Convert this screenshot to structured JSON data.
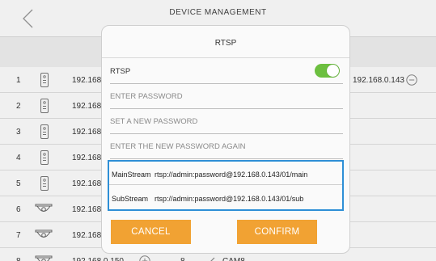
{
  "header": {
    "title": "DEVICE MANAGEMENT"
  },
  "rows": [
    {
      "index": "1",
      "kind": "device",
      "ip": "192.168.",
      "ip_right": "192.168.0.143",
      "has_remove": true
    },
    {
      "index": "2",
      "kind": "device",
      "ip": "192.168."
    },
    {
      "index": "3",
      "kind": "device",
      "ip": "192.168."
    },
    {
      "index": "4",
      "kind": "device",
      "ip": "192.168."
    },
    {
      "index": "5",
      "kind": "device",
      "ip": "192.168."
    },
    {
      "index": "6",
      "kind": "camera",
      "ip": "192.168."
    },
    {
      "index": "7",
      "kind": "camera",
      "ip": "192.168."
    },
    {
      "index": "8",
      "kind": "camera",
      "ip": "192.168.0.150",
      "channel": "8",
      "name": "CAM8"
    }
  ],
  "dialog": {
    "title": "RTSP",
    "rtsp_label": "RTSP",
    "rtsp_enabled": true,
    "enter_password": "ENTER PASSWORD",
    "set_new_password": "SET A NEW PASSWORD",
    "enter_new_password_again": "ENTER THE NEW PASSWORD AGAIN",
    "main_stream_label": "MainStream",
    "main_stream_url": "rtsp://admin:password@192.168.0.143/01/main",
    "sub_stream_label": "SubStream",
    "sub_stream_url": "rtsp://admin:password@192.168.0.143/01/sub",
    "cancel": "CANCEL",
    "confirm": "CONFIRM"
  },
  "colors": {
    "accent_orange": "#f1a233",
    "toggle_green": "#6cbf3f",
    "highlight_blue": "#2e8fd6"
  },
  "icons": {
    "back": "chevron-left-icon",
    "device": "intercom-device-icon",
    "camera": "dome-camera-icon",
    "remove": "minus-circle-icon",
    "add": "plus-circle-icon",
    "edit": "pencil-icon"
  }
}
